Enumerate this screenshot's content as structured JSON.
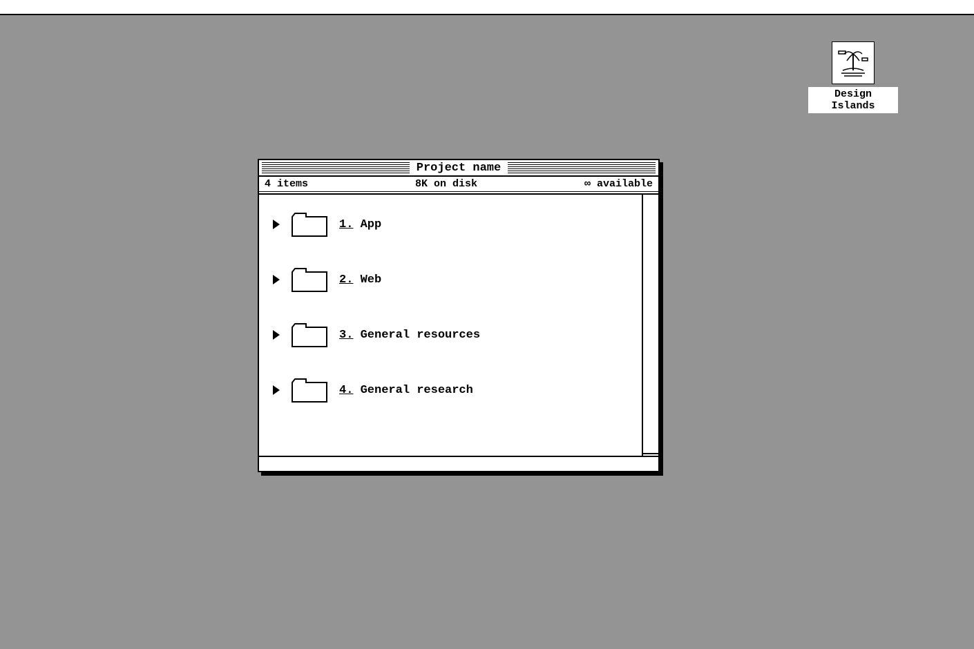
{
  "desktop": {
    "disk_icon_label": "Design Islands"
  },
  "window": {
    "title": "Project name",
    "status": {
      "items": "4 items",
      "disk": "8K on disk",
      "available": "∞ available"
    },
    "folders": [
      {
        "num": "1.",
        "name": "App"
      },
      {
        "num": "2.",
        "name": "Web"
      },
      {
        "num": "3.",
        "name": "General resources"
      },
      {
        "num": "4.",
        "name": "General research"
      }
    ]
  }
}
